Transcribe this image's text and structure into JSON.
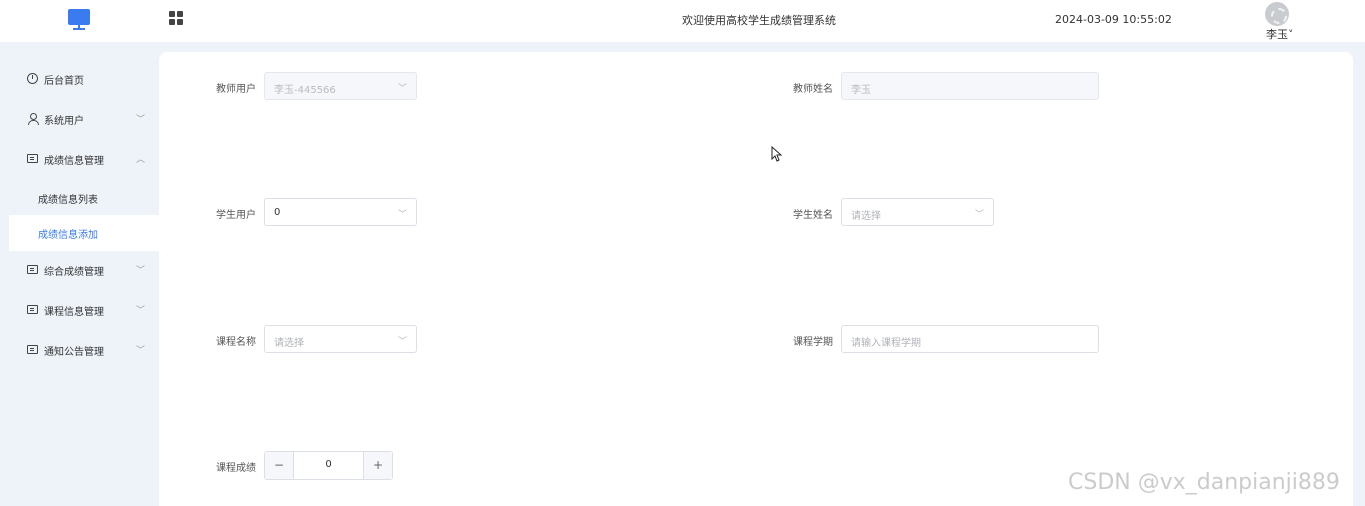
{
  "header": {
    "title": "欢迎使用高校学生成绩管理系统",
    "datetime": "2024-03-09 10:55:02",
    "user_name": "李玉˅",
    "logo_icon": "monitor-icon",
    "menu_toggle_icon": "grid-icon"
  },
  "sidebar": {
    "items": [
      {
        "label": "后台首页",
        "icon": "clock-icon"
      },
      {
        "label": "系统用户",
        "icon": "user-icon",
        "arrow": "﹀"
      },
      {
        "label": "成绩信息管理",
        "icon": "card-icon",
        "arrow": "︿"
      },
      {
        "label": "综合成绩管理",
        "icon": "card-icon",
        "arrow": "﹀"
      },
      {
        "label": "课程信息管理",
        "icon": "card-icon",
        "arrow": "﹀"
      },
      {
        "label": "通知公告管理",
        "icon": "card-icon",
        "arrow": "﹀"
      }
    ],
    "subitems": [
      {
        "label": "成绩信息列表"
      },
      {
        "label": "成绩信息添加",
        "active": true
      }
    ]
  },
  "form": {
    "teacher_user": {
      "label": "教师用户",
      "value": "李玉-445566"
    },
    "teacher_name": {
      "label": "教师姓名",
      "value": "李玉"
    },
    "student_user": {
      "label": "学生用户",
      "value": "0"
    },
    "student_name": {
      "label": "学生姓名",
      "placeholder": "请选择"
    },
    "course_name": {
      "label": "课程名称",
      "placeholder": "请选择"
    },
    "course_term": {
      "label": "课程学期",
      "placeholder": "请输入课程学期"
    },
    "course_score": {
      "label": "课程成绩",
      "value": "0",
      "minus": "−",
      "plus": "+"
    }
  },
  "select_caret": "﹀",
  "watermark": "CSDN @vx_danpianji889",
  "colors": {
    "accent": "#3a7bf0",
    "sidebar_bg": "#eef3fa"
  }
}
